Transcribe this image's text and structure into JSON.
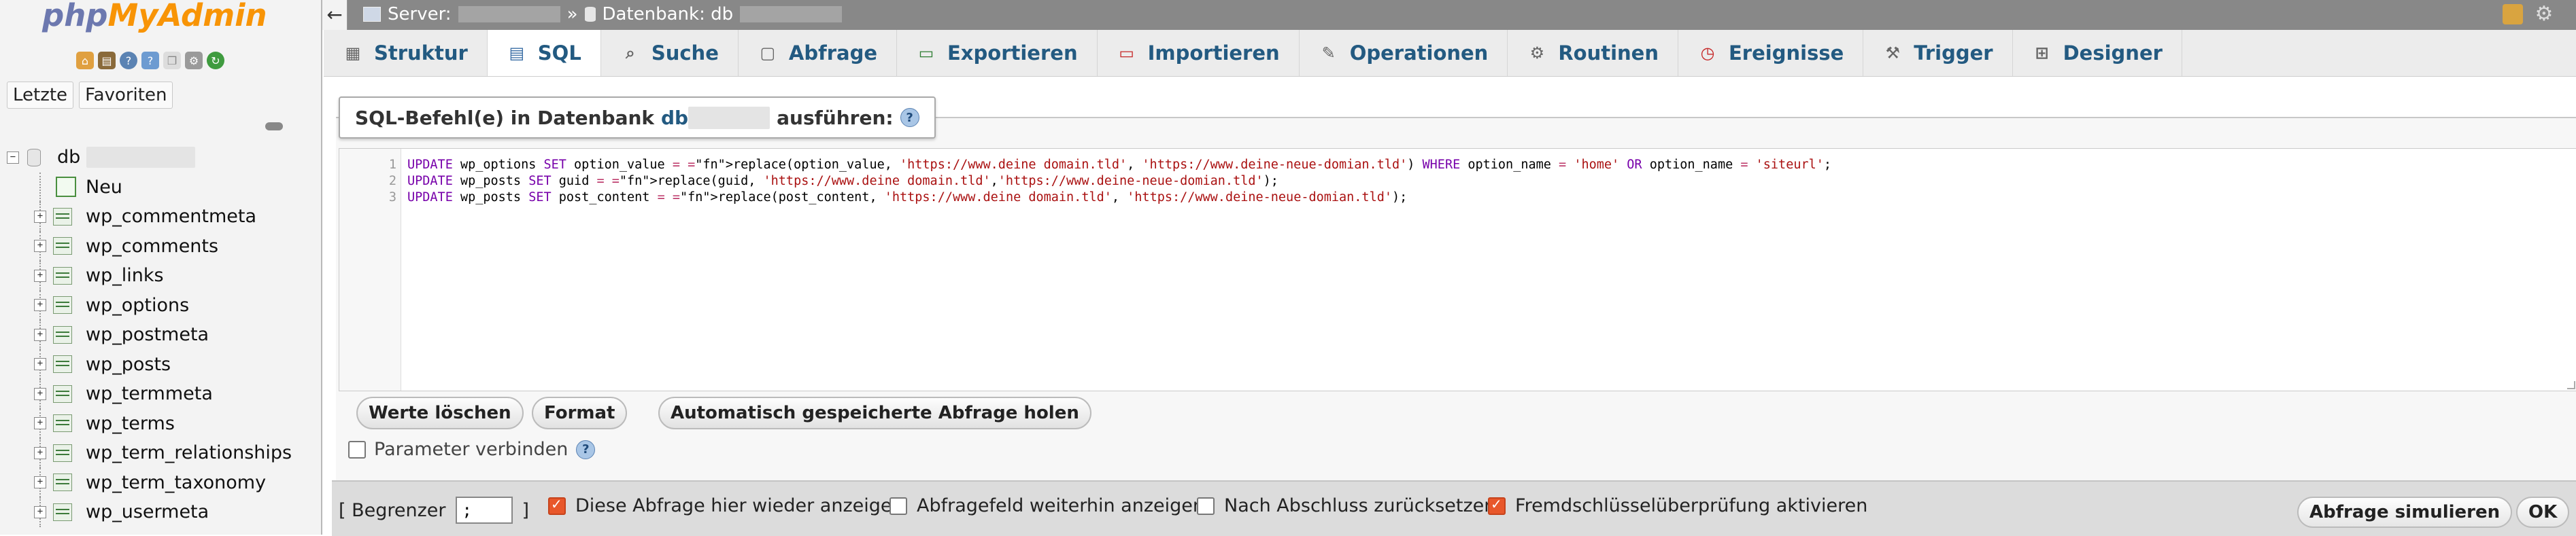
{
  "app": {
    "logo_php": "php",
    "logo_myadmin": "MyAdmin"
  },
  "sidebar": {
    "tabs": [
      "Letzte",
      "Favoriten"
    ],
    "database": "db",
    "new_label": "Neu",
    "tables": [
      "wp_commentmeta",
      "wp_comments",
      "wp_links",
      "wp_options",
      "wp_postmeta",
      "wp_posts",
      "wp_termmeta",
      "wp_terms",
      "wp_term_relationships",
      "wp_term_taxonomy",
      "wp_usermeta"
    ]
  },
  "breadcrumb": {
    "server_label": "Server:",
    "separator": "»",
    "database_label": "Datenbank: db"
  },
  "tabs": [
    {
      "label": "Struktur",
      "icon": "structure-icon"
    },
    {
      "label": "SQL",
      "icon": "sql-icon",
      "active": true
    },
    {
      "label": "Suche",
      "icon": "search-icon"
    },
    {
      "label": "Abfrage",
      "icon": "query-icon"
    },
    {
      "label": "Exportieren",
      "icon": "export-icon"
    },
    {
      "label": "Importieren",
      "icon": "import-icon"
    },
    {
      "label": "Operationen",
      "icon": "wrench-icon"
    },
    {
      "label": "Routinen",
      "icon": "routines-icon"
    },
    {
      "label": "Ereignisse",
      "icon": "clock-icon"
    },
    {
      "label": "Trigger",
      "icon": "trigger-icon"
    },
    {
      "label": "Designer",
      "icon": "designer-icon"
    }
  ],
  "sql_panel": {
    "title_prefix": "SQL-Befehl(e) in Datenbank",
    "db_name": "db",
    "title_suffix": "ausführen:",
    "lines": [
      "UPDATE wp_options SET option_value = replace(option_value, 'https://www.deine domain.tld', 'https://www.deine-neue-domian.tld') WHERE option_name = 'home' OR option_name = 'siteurl';",
      "UPDATE wp_posts SET guid = replace(guid, 'https://www.deine domain.tld','https://www.deine-neue-domian.tld');",
      "UPDATE wp_posts SET post_content = replace(post_content, 'https://www.deine domain.tld', 'https://www.deine-neue-domian.tld');"
    ],
    "buttons": {
      "clear": "Werte löschen",
      "format": "Format",
      "autosaved": "Automatisch gespeicherte Abfrage holen"
    },
    "bind_params_label": "Parameter verbinden"
  },
  "bottom": {
    "delimiter_label_open": "[ Begrenzer",
    "delimiter_value": ";",
    "delimiter_label_close": "]",
    "show_again": {
      "label": "Diese Abfrage hier wieder anzeigen",
      "checked": true
    },
    "keep_field": {
      "label": "Abfragefeld weiterhin anzeigen",
      "checked": false
    },
    "reset_after": {
      "label": "Nach Abschluss zurücksetzen",
      "checked": false
    },
    "fk_checks": {
      "label": "Fremdschlüsselüberprüfung aktivieren",
      "checked": true
    },
    "simulate_button": "Abfrage simulieren",
    "ok_button": "OK"
  },
  "colors": {
    "accent_link": "#235a81",
    "checkbox_checked": "#e8572a",
    "topbar_bg": "#888888"
  }
}
